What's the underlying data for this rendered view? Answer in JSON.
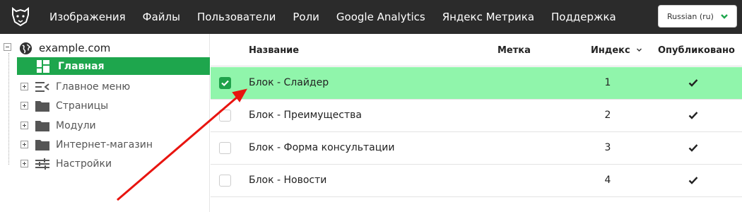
{
  "nav": {
    "items": [
      "Изображения",
      "Файлы",
      "Пользователи",
      "Роли",
      "Google Analytics",
      "Яндекс Метрика",
      "Поддержка"
    ],
    "language": "Russian (ru)"
  },
  "sidebar": {
    "root": "example.com",
    "active": "Главная",
    "items": [
      {
        "label": "Главное меню",
        "icon": "menu-collapse-icon"
      },
      {
        "label": "Страницы",
        "icon": "folder-icon"
      },
      {
        "label": "Модули",
        "icon": "folder-icon"
      },
      {
        "label": "Интернет-магазин",
        "icon": "folder-icon"
      },
      {
        "label": "Настройки",
        "icon": "sliders-icon"
      }
    ]
  },
  "table": {
    "headers": {
      "name": "Название",
      "tag": "Метка",
      "index": "Индекс",
      "published": "Опубликовано"
    },
    "rows": [
      {
        "name": "Блок - Слайдер",
        "tag": "",
        "index": "1",
        "published": true,
        "selected": true
      },
      {
        "name": "Блок - Преимущества",
        "tag": "",
        "index": "2",
        "published": true,
        "selected": false
      },
      {
        "name": "Блок - Форма консультации",
        "tag": "",
        "index": "3",
        "published": true,
        "selected": false
      },
      {
        "name": "Блок - Новости",
        "tag": "",
        "index": "4",
        "published": true,
        "selected": false
      }
    ]
  },
  "colors": {
    "topbar": "#2b2b2b",
    "active_item": "#1ea64d",
    "selected_row": "#90f5ab",
    "annotation_arrow": "#e8140f"
  }
}
